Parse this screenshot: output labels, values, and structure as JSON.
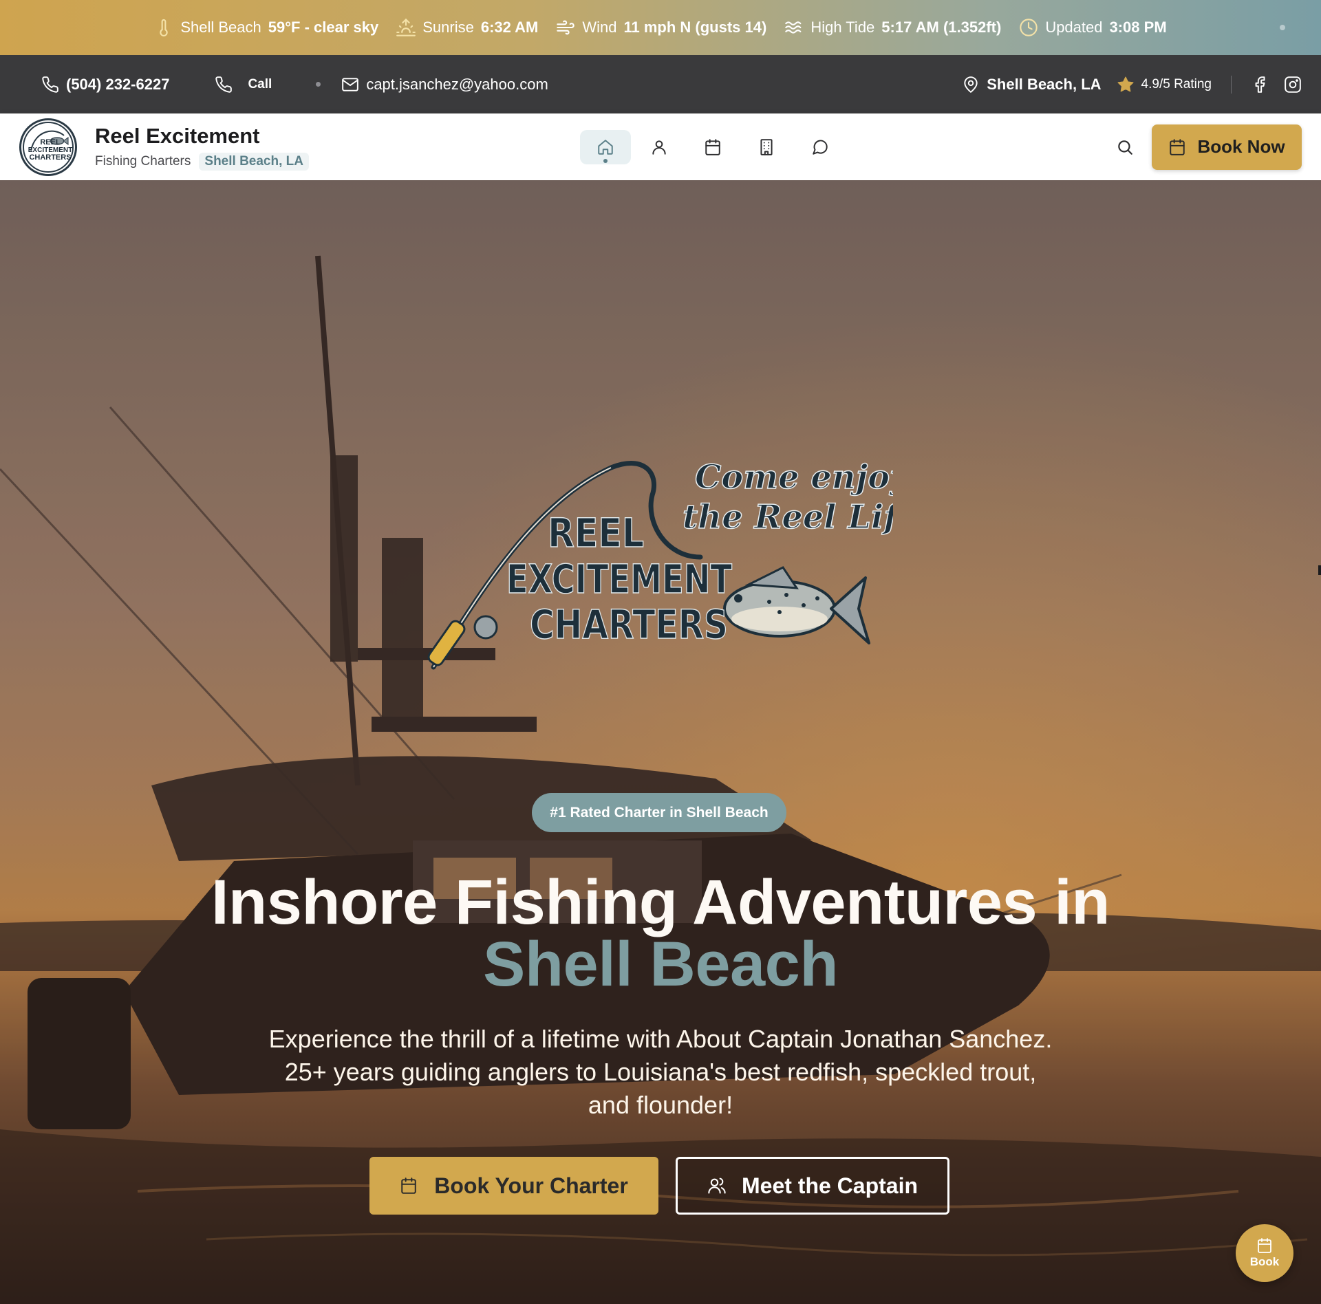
{
  "weather": {
    "location_label": "Shell Beach",
    "temp": "59°F - clear sky",
    "sunrise_label": "Sunrise",
    "sunrise_time": "6:32 AM",
    "wind_label": "Wind",
    "wind_value": "11 mph N (gusts 14)",
    "tide_label": "High Tide",
    "tide_value": "5:17 AM (1.352ft)",
    "updated_label": "Updated",
    "updated_time": "3:08 PM"
  },
  "contact": {
    "phone": "(504) 232-6227",
    "call_label": "Call",
    "email": "capt.jsanchez@yahoo.com",
    "location": "Shell Beach, LA",
    "rating": "4.9/5 Rating"
  },
  "nav": {
    "brand_name": "Reel Excitement",
    "brand_tag": "Fishing Charters",
    "brand_location": "Shell Beach, LA",
    "logo_lines": [
      "REEL",
      "EXCITEMENT",
      "CHARTERS"
    ],
    "book_now": "Book Now",
    "icons": [
      "home-icon",
      "user-icon",
      "calendar-icon",
      "building-icon",
      "chat-icon"
    ]
  },
  "hero": {
    "logo_script_line1": "Come enjoy",
    "logo_script_line2": "the Reel Life",
    "logo_word1": "REEL",
    "logo_word2": "EXCITEMENT",
    "logo_word3": "CHARTERS",
    "badge": "#1 Rated Charter in Shell Beach",
    "title_line1": "Inshore Fishing Adventures in",
    "title_highlight": "Shell Beach",
    "description": "Experience the thrill of a lifetime with About Captain Jonathan Sanchez. 25+ years guiding anglers to Louisiana's best redfish, speckled trout, and flounder!",
    "primary_button": "Book Your Charter",
    "secondary_button": "Meet the Captain",
    "fab_label": "Book"
  },
  "colors": {
    "accent_gold": "#d2a84e",
    "accent_teal": "#7e9ea1",
    "topbar_dark": "#3a3a3c"
  }
}
